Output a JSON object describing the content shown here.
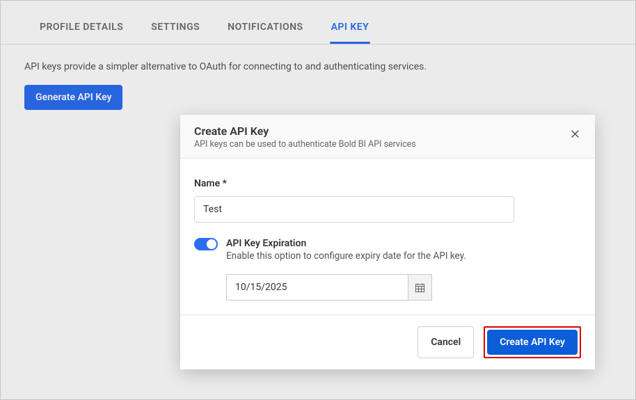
{
  "tabs": [
    {
      "label": "PROFILE DETAILS"
    },
    {
      "label": "SETTINGS"
    },
    {
      "label": "NOTIFICATIONS"
    },
    {
      "label": "API KEY"
    }
  ],
  "page": {
    "description": "API keys provide a simpler alternative to OAuth for connecting to and authenticating services.",
    "generate_btn": "Generate API Key"
  },
  "modal": {
    "title": "Create API Key",
    "subtitle": "API keys can be used to authenticate Bold BI API services",
    "name_label": "Name *",
    "name_value": "Test",
    "expiration_title": "API Key Expiration",
    "expiration_desc": "Enable this option to configure expiry date for the API key.",
    "date_value": "10/15/2025",
    "cancel": "Cancel",
    "create": "Create API Key"
  }
}
